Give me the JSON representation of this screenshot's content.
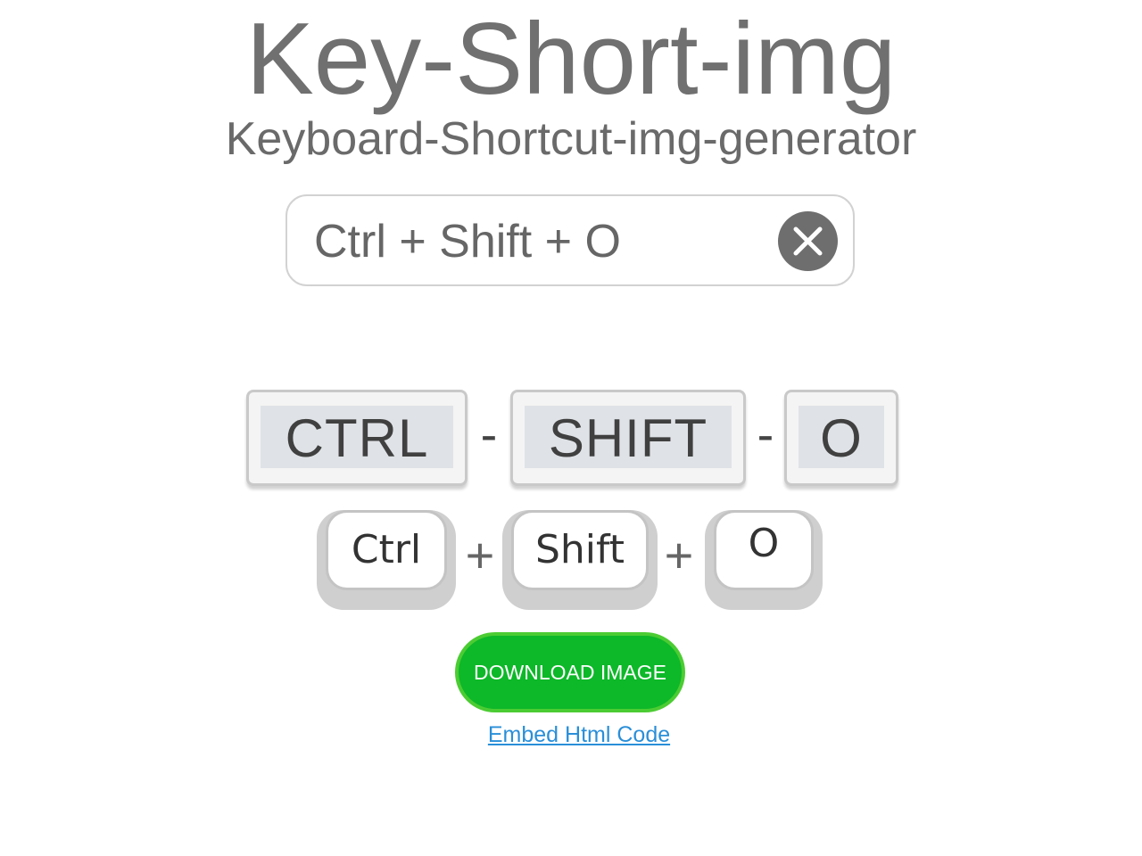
{
  "header": {
    "title": "Key-Short-img",
    "subtitle": "Keyboard-Shortcut-img-generator"
  },
  "search": {
    "value": "Ctrl + Shift + O",
    "clear_icon": "close-icon"
  },
  "preview_style1": {
    "keys": [
      "CTRL",
      "SHIFT",
      "O"
    ],
    "separator": "-"
  },
  "preview_style2": {
    "keys": [
      "Ctrl",
      "Shift",
      "O"
    ],
    "separator": "+"
  },
  "actions": {
    "download_label": "DOWNLOAD IMAGE",
    "embed_label": "Embed Html Code"
  },
  "colors": {
    "title": "#707070",
    "download_bg": "#0db829",
    "download_border": "#4ccc33",
    "link": "#2a8fd8",
    "clear_bg": "#6e6e6e"
  }
}
